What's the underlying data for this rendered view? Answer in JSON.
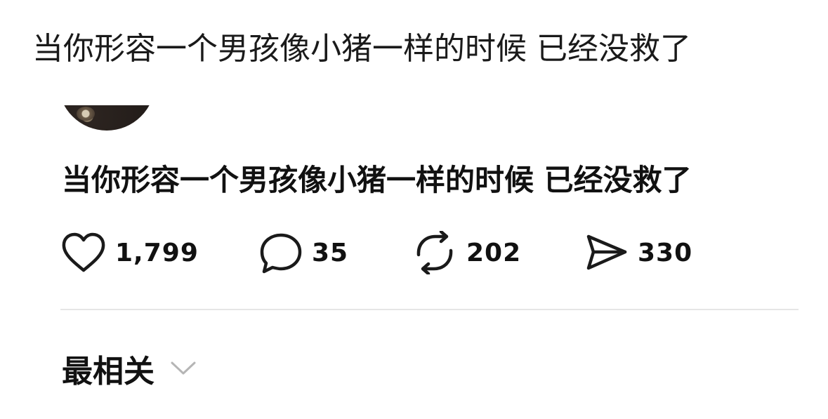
{
  "caption": "当你形容一个男孩像小猪一样的时候 已经没救了",
  "post": {
    "text": "当你形容一个男孩像小猪一样的时候 已经没救了",
    "actions": {
      "like": {
        "icon": "heart-icon",
        "count": "1,799"
      },
      "comment": {
        "icon": "speech-bubble-icon",
        "count": "35"
      },
      "repost": {
        "icon": "repost-icon",
        "count": "202"
      },
      "share": {
        "icon": "paper-plane-icon",
        "count": "330"
      }
    }
  },
  "sort": {
    "label": "最相关",
    "icon": "chevron-down-icon"
  },
  "colors": {
    "text": "#111111",
    "icon": "#1a1a1a",
    "divider": "#e6e6e6",
    "chevron": "#b5b5b5",
    "background": "#ffffff"
  }
}
